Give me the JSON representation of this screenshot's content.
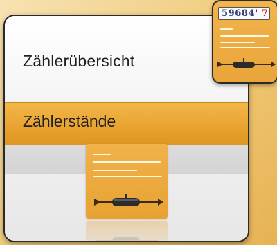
{
  "card": {
    "title": "Zählerübersicht",
    "selected_item": "Zählerstände"
  },
  "thumbnail": {
    "counter_digits": "59684'",
    "counter_last_digit": "7"
  },
  "colors": {
    "accent": "#e8a22f",
    "background": "#f2f2f2",
    "border": "#2a2a2a",
    "counter_red": "#c62020",
    "counter_blue": "#2f3a7a"
  },
  "icons": [
    "meter-reading-document-icon",
    "meter-counter-icon",
    "probe-arrow-icon"
  ]
}
